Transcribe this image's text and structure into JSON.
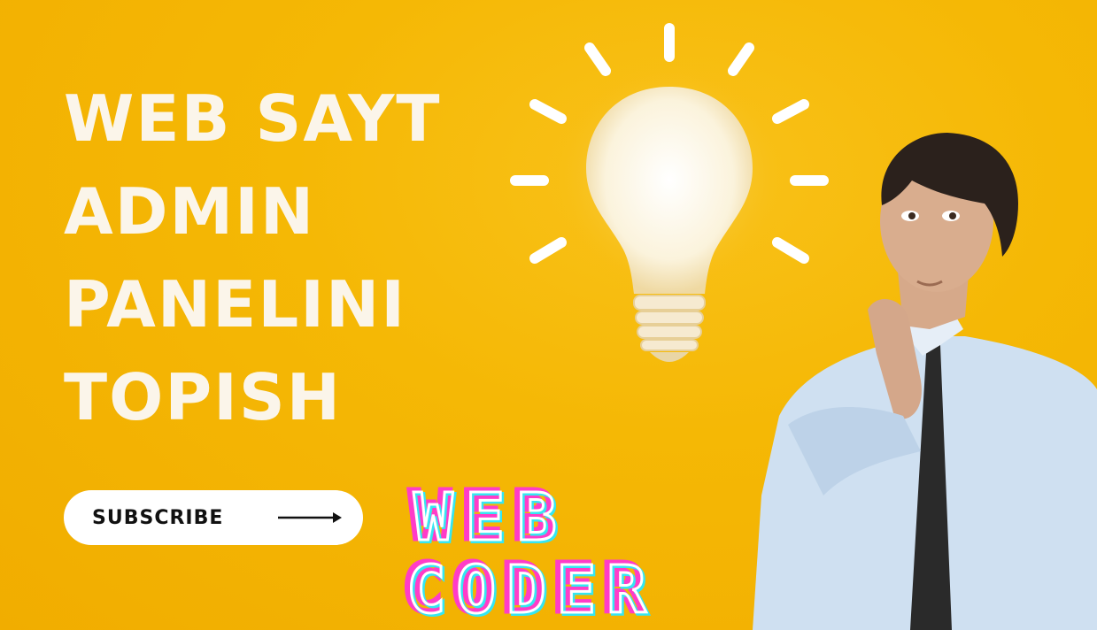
{
  "headline": {
    "lines": [
      "WEB SAYT",
      "ADMIN",
      "PANELINI",
      "TOPISH"
    ]
  },
  "subscribe": {
    "label": "SUBSCRIBE",
    "icon": "arrow-right-icon"
  },
  "logo": {
    "line1": "WEB",
    "line2": "CODER"
  },
  "illustrations": {
    "bulb": "light-bulb-icon",
    "person": "thinking-man-illustration"
  },
  "colors": {
    "background": "#f5b805",
    "headline": "#fbf5ea",
    "logo_pink": "#ff3cc8",
    "logo_cyan": "#35e6f2"
  }
}
